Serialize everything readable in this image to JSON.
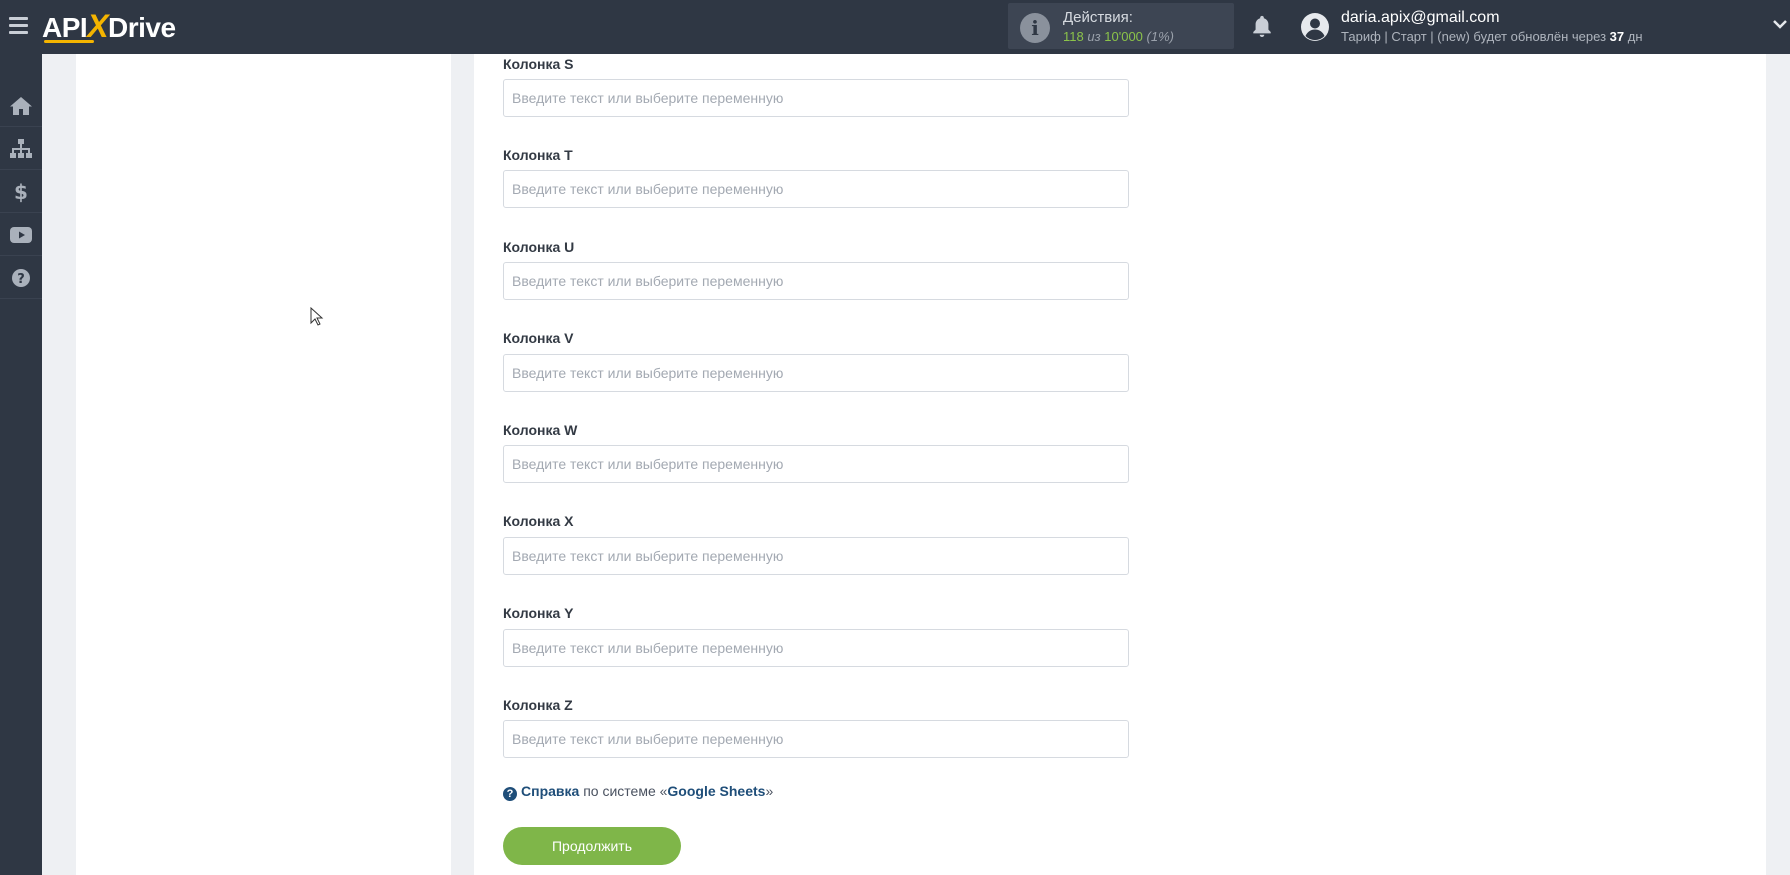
{
  "header": {
    "logo_left": "API",
    "logo_x": "X",
    "logo_right": "Drive",
    "actions_title": "Действия:",
    "actions_used": "118",
    "actions_of": "из",
    "actions_total": "10'000",
    "actions_pct": "(1%)",
    "user_email": "daria.apix@gmail.com",
    "plan_text": "Тариф | Старт | (new) будет обновлён через",
    "plan_days": "37",
    "plan_days_unit": "дн"
  },
  "rail": {
    "icons": [
      "home-icon",
      "sitemap-icon",
      "dollar-icon",
      "youtube-icon",
      "help-icon"
    ]
  },
  "form": {
    "fields": [
      {
        "label": "Колонка S",
        "placeholder": "Введите текст или выберите переменную",
        "value": ""
      },
      {
        "label": "Колонка T",
        "placeholder": "Введите текст или выберите переменную",
        "value": ""
      },
      {
        "label": "Колонка U",
        "placeholder": "Введите текст или выберите переменную",
        "value": ""
      },
      {
        "label": "Колонка V",
        "placeholder": "Введите текст или выберите переменную",
        "value": ""
      },
      {
        "label": "Колонка W",
        "placeholder": "Введите текст или выберите переменную",
        "value": ""
      },
      {
        "label": "Колонка X",
        "placeholder": "Введите текст или выберите переменную",
        "value": ""
      },
      {
        "label": "Колонка Y",
        "placeholder": "Введите текст или выберите переменную",
        "value": ""
      },
      {
        "label": "Колонка Z",
        "placeholder": "Введите текст или выберите переменную",
        "value": ""
      }
    ],
    "help_link": "Справка",
    "help_mid": "по системе «",
    "help_system": "Google Sheets",
    "help_end": "»",
    "continue_label": "Продолжить"
  },
  "colors": {
    "topbar": "#2f3744",
    "accent_green": "#7fb649",
    "logo_accent": "#f4b400",
    "link_blue": "#1f4e79"
  }
}
